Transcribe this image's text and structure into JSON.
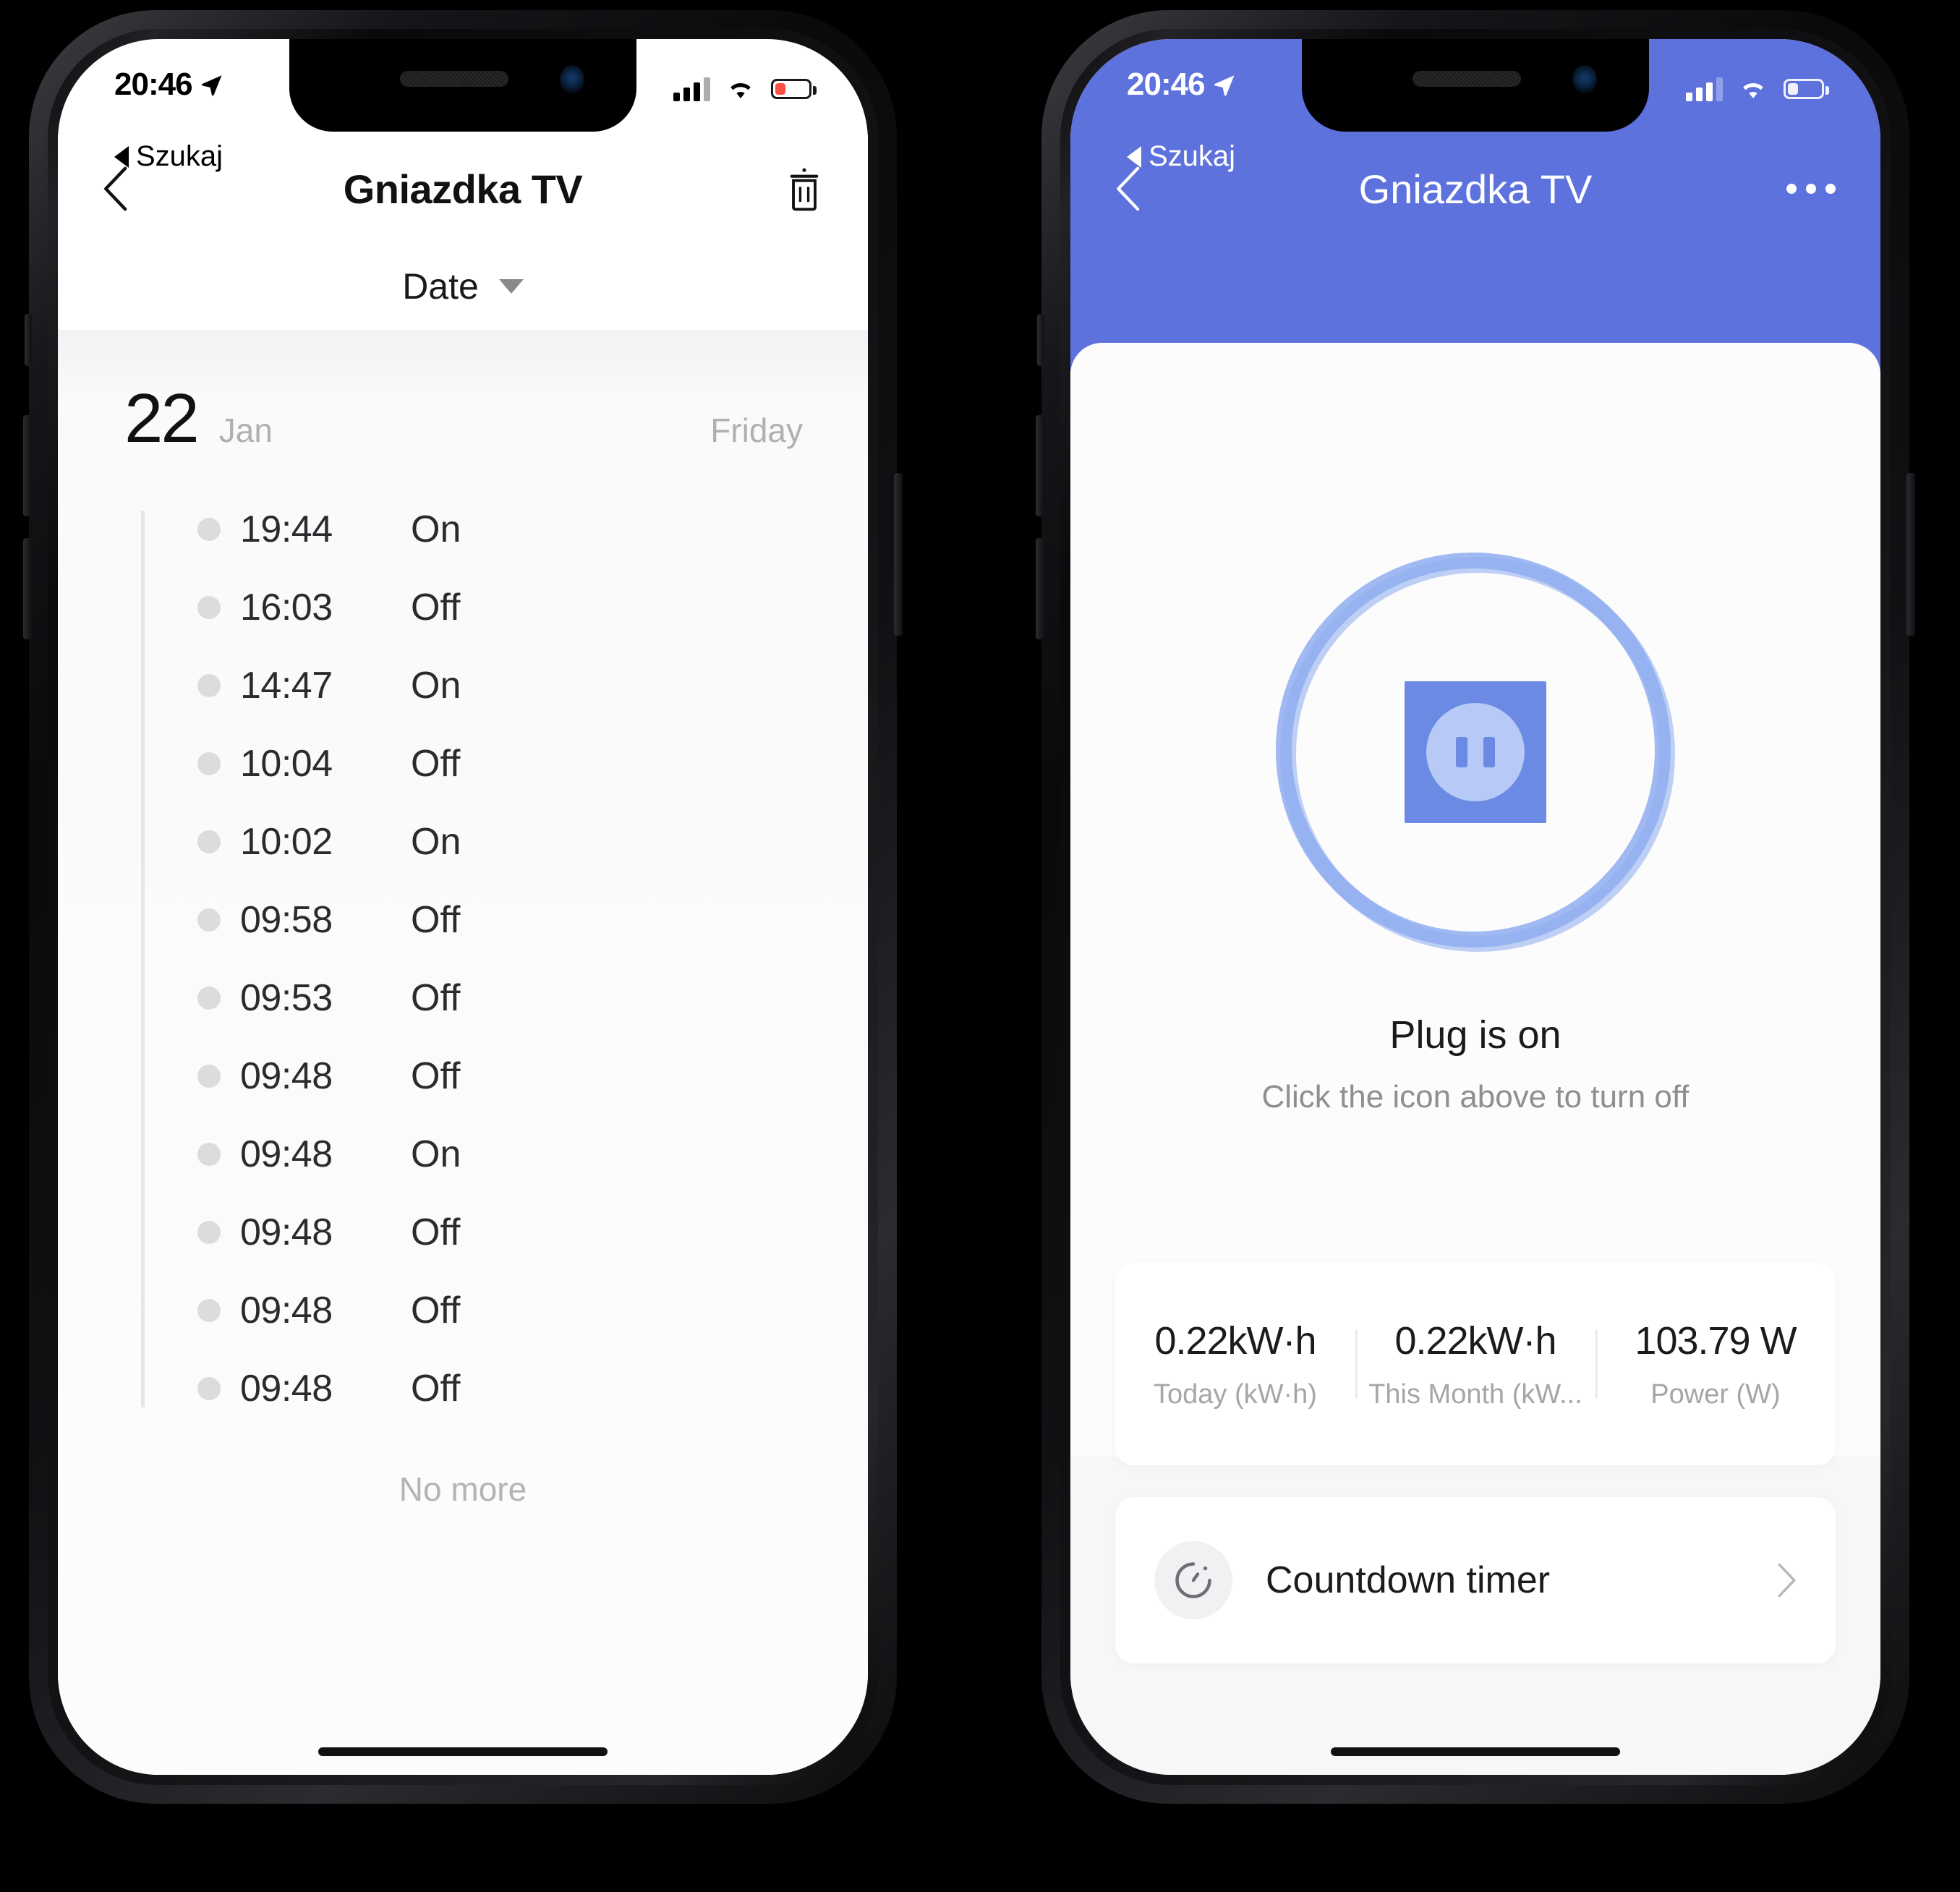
{
  "theme": {
    "accent": "#5e72de",
    "plug_blue": "#6a8ae4",
    "plug_light": "#b6c9f7",
    "ring_light": "#a9c0f3",
    "ring_mid": "#8fadf0",
    "battery_low": "#ff3b30"
  },
  "status_bar": {
    "time": "20:46",
    "location_icon": "location-arrow-icon",
    "back_app_label": "Szukaj",
    "signal_icon": "cellular-signal-icon",
    "wifi_icon": "wifi-icon",
    "battery_icon": "battery-icon"
  },
  "left_phone": {
    "nav": {
      "back_icon": "chevron-left-icon",
      "title": "Gniazdka TV",
      "delete_icon": "trash-icon"
    },
    "filter": {
      "label": "Date",
      "caret_icon": "chevron-down-icon"
    },
    "day": {
      "number": "22",
      "month": "Jan",
      "weekday": "Friday"
    },
    "events": [
      {
        "time": "19:44",
        "state": "On"
      },
      {
        "time": "16:03",
        "state": "Off"
      },
      {
        "time": "14:47",
        "state": "On"
      },
      {
        "time": "10:04",
        "state": "Off"
      },
      {
        "time": "10:02",
        "state": "On"
      },
      {
        "time": "09:58",
        "state": "Off"
      },
      {
        "time": "09:53",
        "state": "Off"
      },
      {
        "time": "09:48",
        "state": "Off"
      },
      {
        "time": "09:48",
        "state": "On"
      },
      {
        "time": "09:48",
        "state": "Off"
      },
      {
        "time": "09:48",
        "state": "Off"
      },
      {
        "time": "09:48",
        "state": "Off"
      }
    ],
    "footer": "No more"
  },
  "right_phone": {
    "nav": {
      "back_icon": "chevron-left-icon",
      "title": "Gniazdka TV",
      "more_icon": "more-horizontal-icon"
    },
    "plug": {
      "icon": "power-socket-icon",
      "state": "Plug is on",
      "hint": "Click the icon above to turn off"
    },
    "stats": [
      {
        "value": "0.22kW·h",
        "label": "Today (kW·h)"
      },
      {
        "value": "0.22kW·h",
        "label": "This Month (kW..."
      },
      {
        "value": "103.79 W",
        "label": "Power (W)"
      }
    ],
    "timer": {
      "icon": "timer-icon",
      "label": "Countdown timer",
      "chevron_icon": "chevron-right-icon"
    }
  }
}
